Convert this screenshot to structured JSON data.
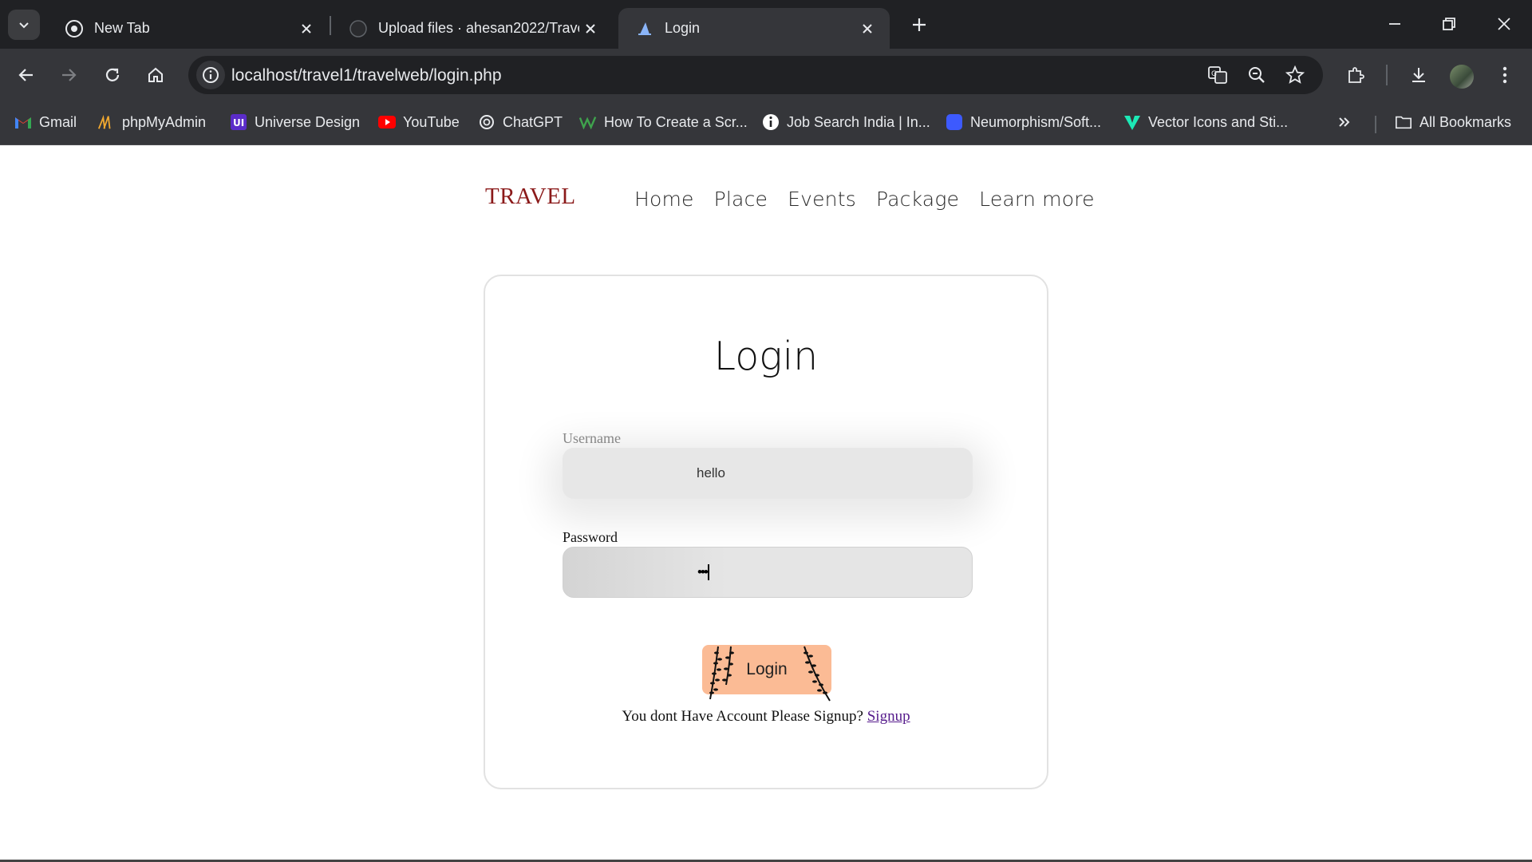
{
  "browser": {
    "tabs": [
      {
        "title": "New Tab",
        "active": false
      },
      {
        "title": "Upload files · ahesan2022/Trave",
        "active": false
      },
      {
        "title": "Login",
        "active": true
      }
    ],
    "url": "localhost/travel1/travelweb/login.php",
    "bookmarks": [
      {
        "label": "Gmail",
        "icon": "gmail-icon"
      },
      {
        "label": "phpMyAdmin",
        "icon": "phpmyadmin-icon"
      },
      {
        "label": "Universe Design",
        "icon": "ui-icon"
      },
      {
        "label": "YouTube",
        "icon": "youtube-icon"
      },
      {
        "label": "ChatGPT",
        "icon": "chatgpt-icon"
      },
      {
        "label": "How To Create a Scr...",
        "icon": "w-icon"
      },
      {
        "label": "Job Search India | In...",
        "icon": "info-icon"
      },
      {
        "label": "Neumorphism/Soft...",
        "icon": "square-icon"
      },
      {
        "label": "Vector Icons and Sti...",
        "icon": "v-icon"
      }
    ],
    "all_bookmarks": "All Bookmarks"
  },
  "site": {
    "brand": "TRAVEL",
    "nav": [
      "Home",
      "Place",
      "Events",
      "Package",
      "Learn more"
    ]
  },
  "login": {
    "title": "Login",
    "username_label": "Username",
    "username_value": "hello",
    "password_label": "Password",
    "password_value": "•••",
    "button": "Login",
    "signup_prompt": "You dont Have Account Please Signup?",
    "signup_link": "Signup"
  },
  "colors": {
    "brand": "#8b1a1a",
    "button_bg": "#fbbb95",
    "link": "#551a8b"
  }
}
